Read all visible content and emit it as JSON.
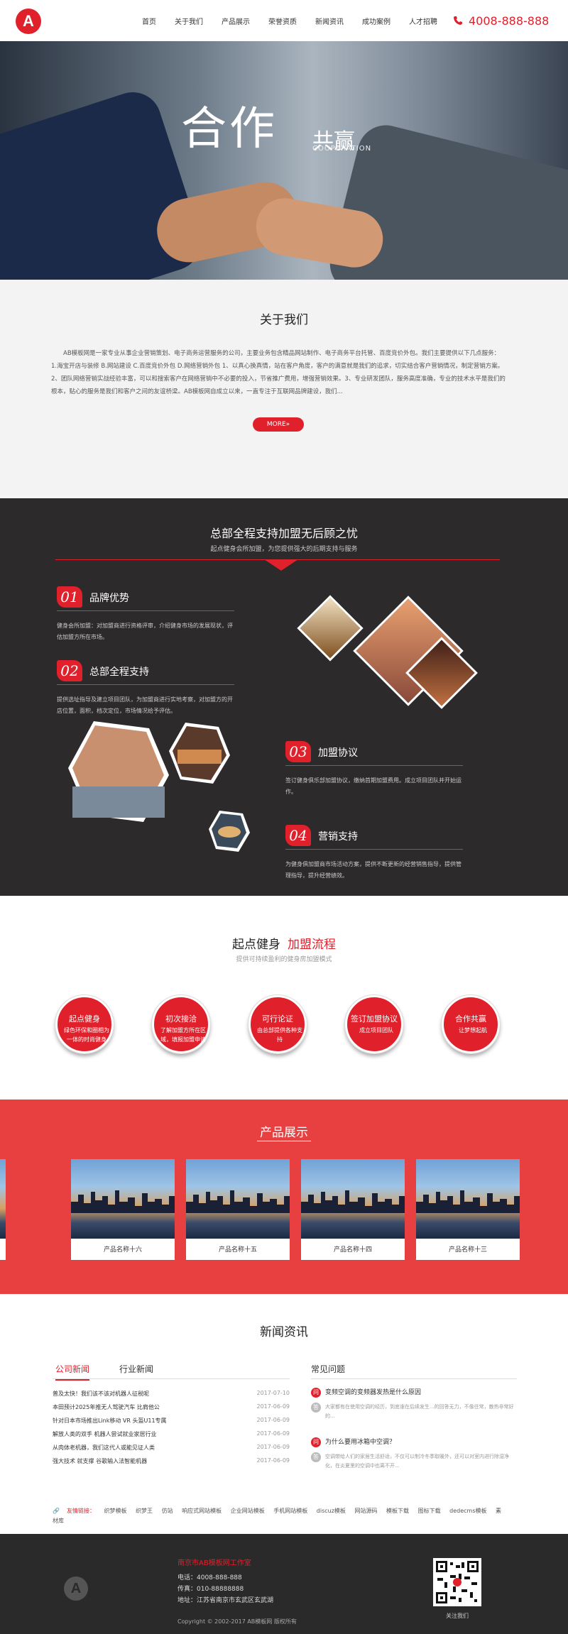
{
  "header": {
    "logo_letter": "A",
    "nav": [
      "首页",
      "关于我们",
      "产品展示",
      "荣誉资质",
      "新闻资讯",
      "成功案例",
      "人才招聘"
    ],
    "phone": "4008-888-888"
  },
  "banner": {
    "title": "合作",
    "title2": "共赢",
    "english": "COOPERATION"
  },
  "about": {
    "title": "关于我们",
    "text": "AB模板网是一家专业从事企业营销策划、电子商务运营服务的公司，主要业务包含精品网站制作、电子商务平台托管、百度竞价外包。我们主要提供以下几点服务：1.海宝开店与装修 B.网站建设 C.百度竞价外包 D.网络营销外包 1、以真心换真情，站在客户角度，客户的满意就是我们的追求，切实结合客户营销情况，制定营销方案。2、团队网络营销实战经验丰富，可以和搜索客户在网络营销中不必要的投入，节省推广费用，增强营销效果。3、专业研发团队，服务高度准确，专业的技术水平是我们的根本，贴心的服务是我们和客户之间的友谊桥梁。AB模板网自成立以来，一直专注于互联网品牌建设，我们...",
    "more": "MORE»"
  },
  "support": {
    "title": "总部全程支持加盟无后顾之忧",
    "subtitle": "起点健身会所加盟，为您提供强大的后期支持与服务",
    "features": [
      {
        "num": "01",
        "title": "品牌优势",
        "text": "健身会所加盟：对加盟商进行资格评审，介绍健身市场的发展现状，评估加盟方所在市场。"
      },
      {
        "num": "02",
        "title": "总部全程支持",
        "text": "提供选址指导及建立项目团队，为加盟商进行实地考察，对加盟方的开店位置，面积，档次定位，市场情况给予评估。"
      },
      {
        "num": "03",
        "title": "加盟协议",
        "text": "签订健身俱乐部加盟协议，缴纳首期加盟费用。成立项目团队并开始运作。"
      },
      {
        "num": "04",
        "title": "营销支持",
        "text": "为健身俱加盟商市场活动方案，提供不断更新的经营销售指导，提供管理指导，提升经营绩效。"
      }
    ]
  },
  "process": {
    "title_a": "起点健身",
    "title_b": "加盟流程",
    "subtitle": "提供可持续盈利的健身房加盟模式",
    "steps": [
      {
        "title": "起点健身",
        "text": "绿色环保和圈相为一体的时尚健身"
      },
      {
        "title": "初次接洽",
        "text": "了解加盟方所在区域，填报加盟申请"
      },
      {
        "title": "可行论证",
        "text": "由总部提供各种支持"
      },
      {
        "title": "签订加盟协议",
        "text": "成立项目团队"
      },
      {
        "title": "合作共赢",
        "text": "让梦想起航"
      }
    ]
  },
  "products": {
    "title": "产品展示",
    "items": [
      "产品名称十六",
      "产品名称十五",
      "产品名称十四",
      "产品名称十三"
    ]
  },
  "news": {
    "title": "新闻资讯",
    "tab_active": "公司新闻",
    "tab_other": "行业新闻",
    "rows": [
      {
        "title": "普及太快！我们该不该对机器人征税呢",
        "date": "2017-07-10"
      },
      {
        "title": "本田预计2025年推无人驾驶汽车 比肩他公",
        "date": "2017-06-09"
      },
      {
        "title": "针对日本市场推出Link移动 VR 头盔U11专属",
        "date": "2017-06-09"
      },
      {
        "title": "解放人类的双手 机器人尝试就业家居行业",
        "date": "2017-06-09"
      },
      {
        "title": "从肉体老机器，我们这代人或能见证人类",
        "date": "2017-06-09"
      },
      {
        "title": "强大技术 就支撑 谷歌输入法智能机器",
        "date": "2017-06-09"
      }
    ],
    "faq_title": "常见问题",
    "faq": [
      {
        "q": "变频空调的变频器发热是什么原因",
        "a": "大家都有在使用空调的经历，到底谁在后续发生...的回答无力，不像往常，散热非常好的..."
      },
      {
        "q": "为什么要用冰箱中空调？",
        "a": "空调带给人们的家居生活舒适，不仅可以制冷冬季取暖外，还可以对室内进行除湿净化，在炎夏里的空调中也离不开..."
      }
    ]
  },
  "links": {
    "label": "友情链接：",
    "items": [
      "织梦模板",
      "织梦王",
      "仿站",
      "响应式网站模板",
      "企业网站模板",
      "手机网站模板",
      "discuz模板",
      "网站源码",
      "模板下载",
      "图标下载",
      "dedecms模板",
      "素材库"
    ]
  },
  "footer": {
    "logo_letter": "A",
    "company": "南京市AB模板网工作室",
    "tel": "电话：4008-888-888",
    "fax": "传真：010-88888888",
    "addr": "地址：江苏省南京市玄武区玄武湖",
    "copyright": "Copyright © 2002-2017 AB模板网 版权所有",
    "qr_label": "关注我们"
  },
  "colors": {
    "accent": "#e0212c",
    "dark": "#2c2a2a",
    "product_bg": "#e84040"
  }
}
